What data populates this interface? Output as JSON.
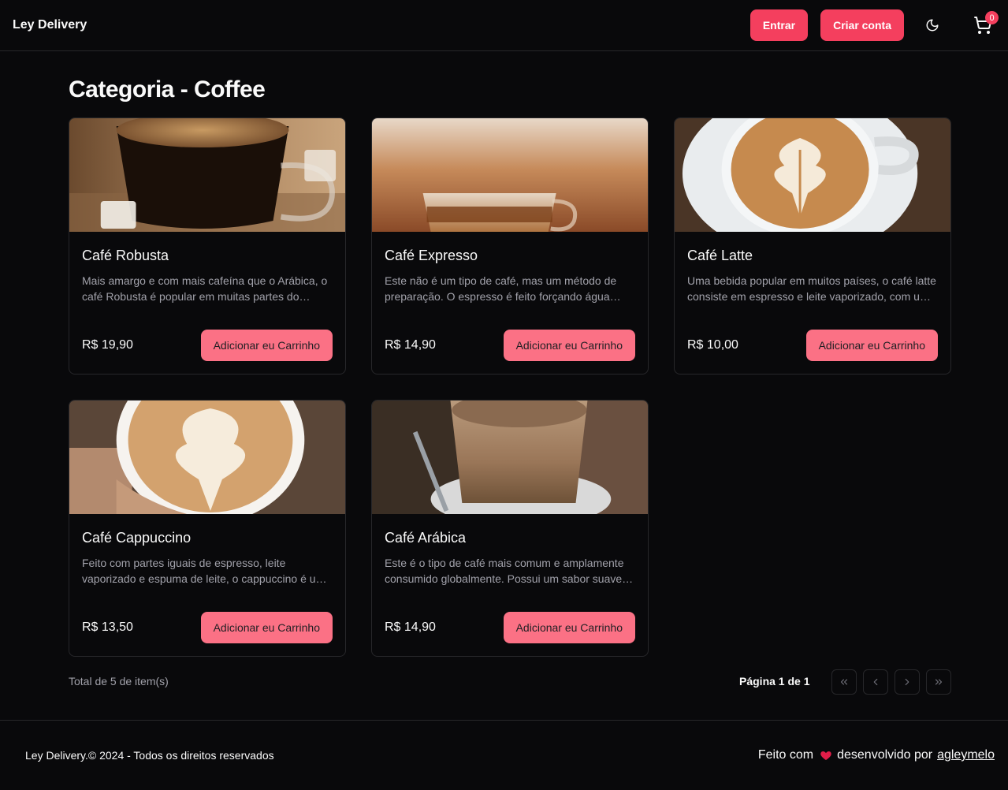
{
  "header": {
    "brand": "Ley Delivery",
    "login_label": "Entrar",
    "signup_label": "Criar conta",
    "theme_icon": "moon-icon",
    "cart_icon": "cart-icon",
    "cart_count": "0"
  },
  "main": {
    "title": "Categoria - Coffee",
    "products": [
      {
        "name": "Café Robusta",
        "description": "Mais amargo e com mais cafeína que o Arábica, o café Robusta é popular em muitas partes do mundo e frequentemente usado em blends.",
        "price": "R$ 19,90",
        "button": "Adicionar eu Carrinho",
        "image": "black-coffee-glass-cup-photo"
      },
      {
        "name": "Café Expresso",
        "description": "Este não é um tipo de café, mas um método de preparação. O espresso é feito forçando água quente sob pressão através do café moído.",
        "price": "R$ 14,90",
        "button": "Adicionar eu Carrinho",
        "image": "espresso-shot-glass-photo"
      },
      {
        "name": "Café Latte",
        "description": "Uma bebida popular em muitos países, o café latte consiste em espresso e leite vaporizado, com uma fina camada de espuma.",
        "price": "R$ 10,00",
        "button": "Adicionar eu Carrinho",
        "image": "latte-art-cup-photo"
      },
      {
        "name": "Café Cappuccino",
        "description": "Feito com partes iguais de espresso, leite vaporizado e espuma de leite, o cappuccino é um clássico italiano.",
        "price": "R$ 13,50",
        "button": "Adicionar eu Carrinho",
        "image": "cappuccino-in-hand-photo"
      },
      {
        "name": "Café Arábica",
        "description": "Este é o tipo de café mais comum e amplamente consumido globalmente. Possui um sabor suave e aromático.",
        "price": "R$ 14,90",
        "button": "Adicionar eu Carrinho",
        "image": "latte-glass-on-saucer-photo"
      }
    ],
    "total": "Total de 5 de item(s)",
    "pagination": {
      "label": "Página 1 de 1",
      "first_icon": "chevrons-left-icon",
      "prev_icon": "chevron-left-icon",
      "next_icon": "chevron-right-icon",
      "last_icon": "chevrons-right-icon"
    }
  },
  "footer": {
    "copyright": "Ley Delivery.© 2024 - Todos os direitos reservados",
    "made_with": "Feito com",
    "heart_icon": "heart-icon",
    "developed_by": "desenvolvido por",
    "author": "agleymelo"
  },
  "colors": {
    "background": "#09090b",
    "accent": "#f43f5e",
    "button_soft": "#fb7185",
    "border": "#27272a",
    "muted_text": "#a1a1aa"
  }
}
